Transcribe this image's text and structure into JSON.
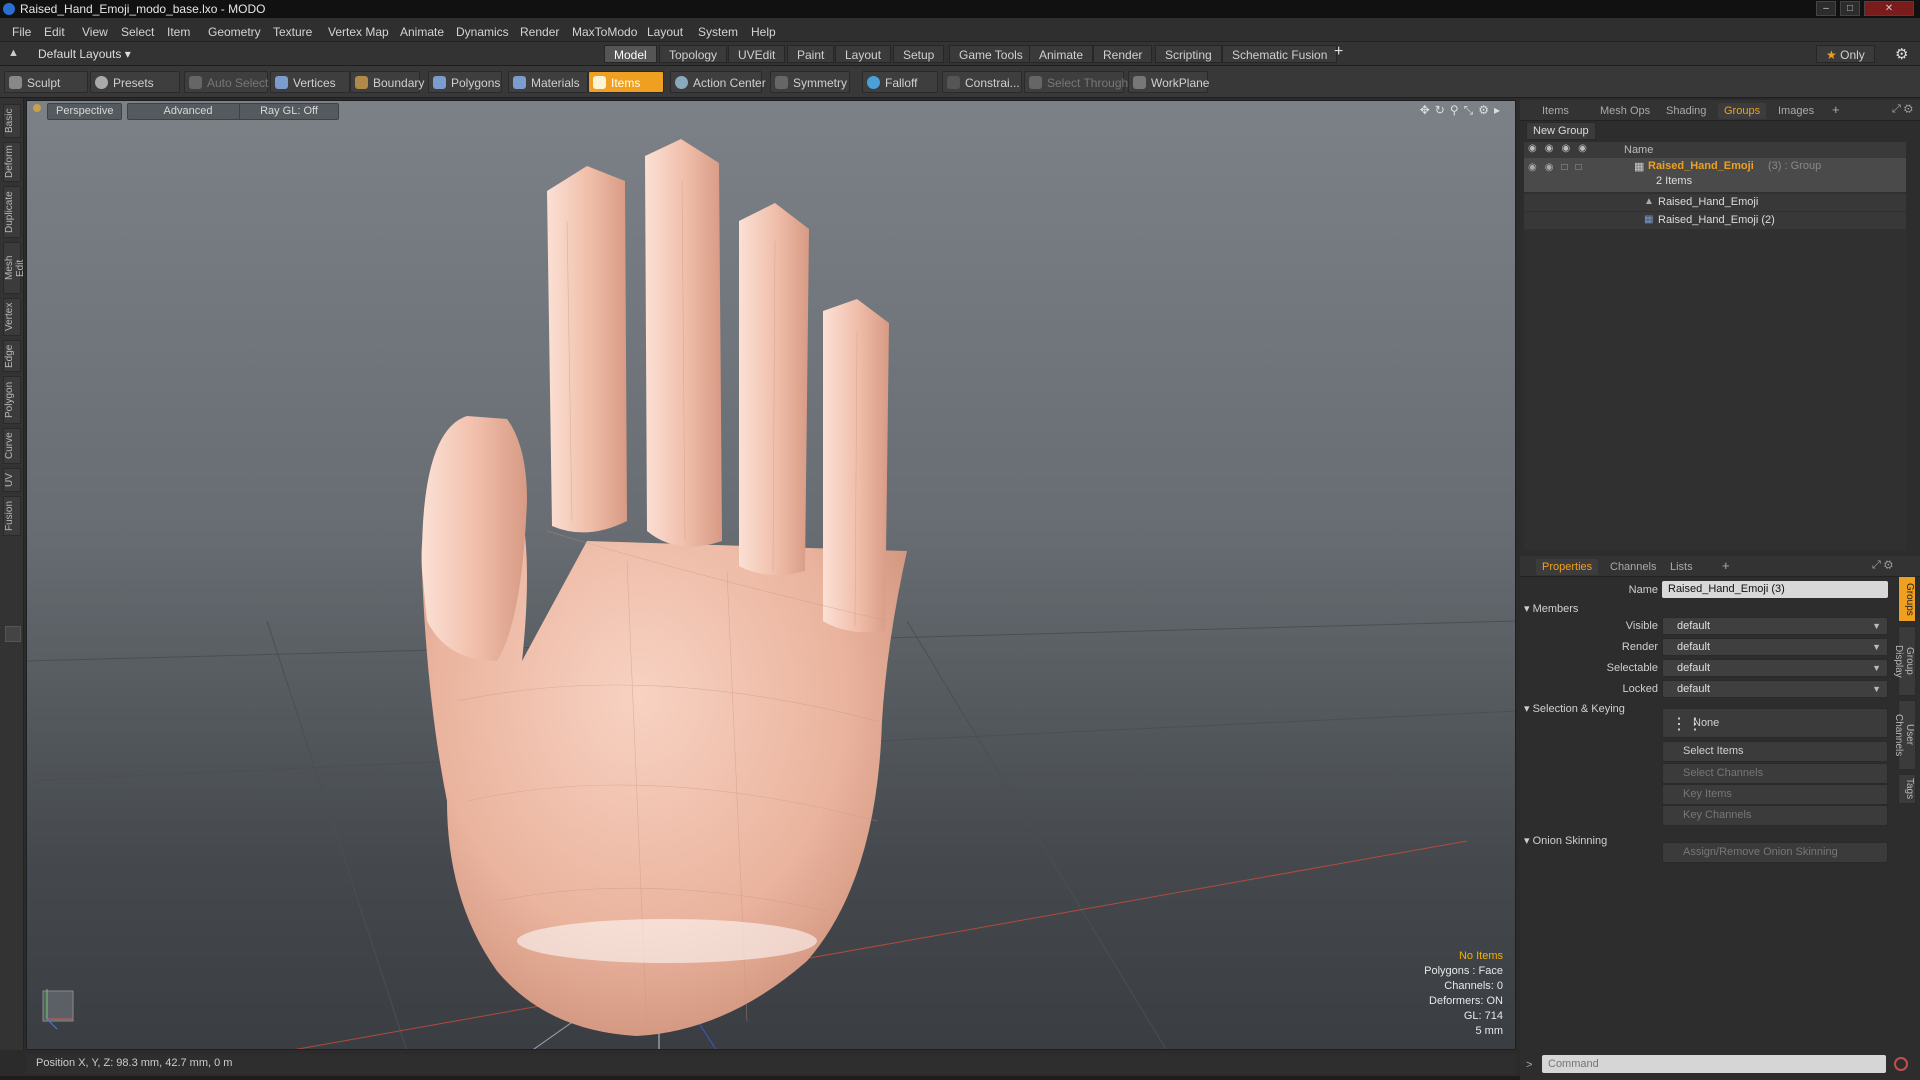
{
  "window": {
    "title": "Raised_Hand_Emoji_modo_base.lxo - MODO"
  },
  "menu": [
    "File",
    "Edit",
    "View",
    "Select",
    "Item",
    "Geometry",
    "Texture",
    "Vertex Map",
    "Animate",
    "Dynamics",
    "Render",
    "MaxToModo",
    "Layout",
    "System",
    "Help"
  ],
  "layout_row": {
    "layouts_label": "Default Layouts",
    "tabs": [
      "Model",
      "Topology",
      "UVEdit",
      "Paint",
      "Layout",
      "Setup",
      "Game Tools",
      "Animate",
      "Render",
      "Scripting",
      "Schematic Fusion"
    ],
    "active_tab": "Model",
    "only_label": "Only"
  },
  "tool_row": {
    "sculpt": "Sculpt",
    "presets": "Presets",
    "auto_select": "Auto Select",
    "vertices": "Vertices",
    "boundary": "Boundary",
    "polygons": "Polygons",
    "materials": "Materials",
    "items": "Items",
    "action_center": "Action Center",
    "symmetry": "Symmetry",
    "falloff": "Falloff",
    "constraints": "Constrai...",
    "select_through": "Select Through",
    "workplane": "WorkPlane"
  },
  "left_tabs": [
    "Basic",
    "Deform",
    "Duplicate",
    "Mesh Edit",
    "Vertex",
    "Edge",
    "Polygon",
    "Curve",
    "UV",
    "Fusion"
  ],
  "viewport": {
    "perspective": "Perspective",
    "advanced": "Advanced",
    "raygl": "Ray GL: Off",
    "hud": {
      "no_items": "No Items",
      "polygons": "Polygons : Face",
      "channels": "Channels: 0",
      "deformers": "Deformers: ON",
      "gl": "GL: 714",
      "scale": "5 mm"
    }
  },
  "status": {
    "position": "Position X, Y, Z:  98.3 mm, 42.7 mm, 0 m"
  },
  "groups_panel": {
    "tabs": [
      "Items",
      "Mesh Ops",
      "Shading",
      "Groups",
      "Images"
    ],
    "active_tab": "Groups",
    "new_group": "New Group",
    "column_name": "Name",
    "group_name": "Raised_Hand_Emoji",
    "group_suffix": "(3) : Group",
    "group_count": "2 Items",
    "children": [
      "Raised_Hand_Emoji",
      "Raised_Hand_Emoji (2)"
    ]
  },
  "properties_panel": {
    "tabs": [
      "Properties",
      "Channels",
      "Lists"
    ],
    "active_tab": "Properties",
    "name_label": "Name",
    "name_value": "Raised_Hand_Emoji (3)",
    "members_header": "Members",
    "fields": [
      {
        "label": "Visible",
        "value": "default"
      },
      {
        "label": "Render",
        "value": "default"
      },
      {
        "label": "Selectable",
        "value": "default"
      },
      {
        "label": "Locked",
        "value": "default"
      }
    ],
    "selection_header": "Selection & Keying",
    "none_label": "None",
    "select_items": "Select Items",
    "select_channels": "Select Channels",
    "key_items": "Key Items",
    "key_channels": "Key Channels",
    "onion_header": "Onion Skinning",
    "onion_btn": "Assign/Remove Onion Skinning",
    "side_tabs": [
      "Groups",
      "Group Display",
      "User Channels",
      "Tags"
    ]
  },
  "command": {
    "placeholder": "Command"
  },
  "colors": {
    "accent": "#f0a020",
    "skin": "#f2c2ad"
  }
}
